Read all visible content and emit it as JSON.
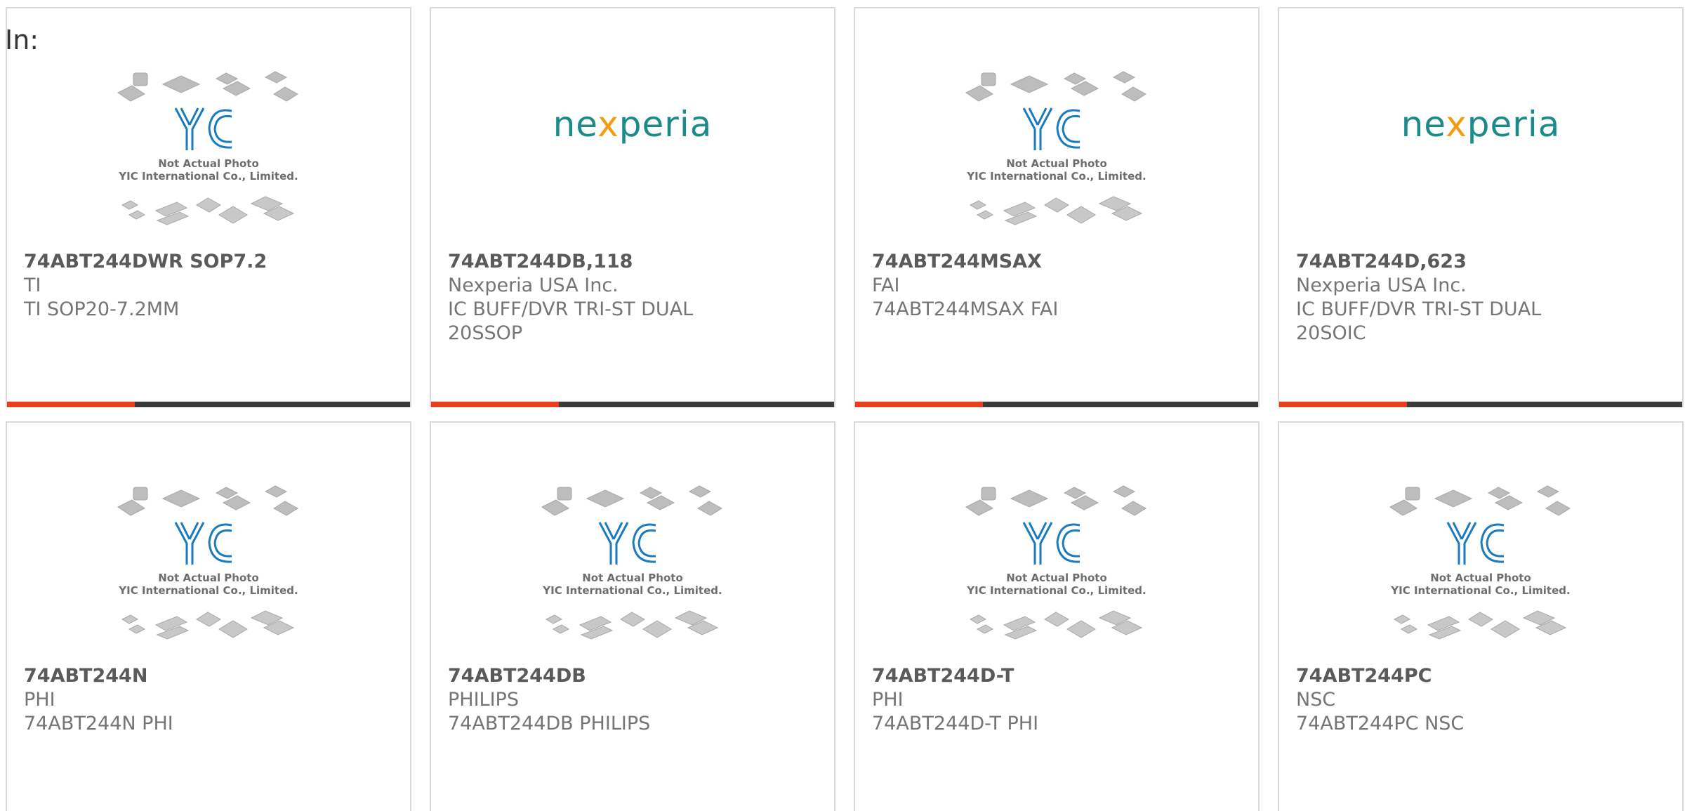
{
  "heading": "In:",
  "colors": {
    "accent": "#e8401c",
    "bar_dark": "#3b3b3b",
    "nexperia_teal": "#1d8a8a",
    "nexperia_orange": "#f39c12",
    "yic_blue": "#1a7bbd"
  },
  "placeholder_image": {
    "caption_line1": "Not Actual Photo",
    "caption_line2": "YIC International Co., Limited.",
    "logo_text": "YIC"
  },
  "nexperia_logo": {
    "before": "ne",
    "x": "x",
    "after": "peria"
  },
  "products": [
    {
      "name": "74ABT244DWR SOP7.2",
      "manufacturer": "TI",
      "description": "TI SOP20-7.2MM",
      "description2": "",
      "image": "yic-placeholder",
      "has_bar": true
    },
    {
      "name": "74ABT244DB,118",
      "manufacturer": "Nexperia USA Inc.",
      "description": "IC BUFF/DVR TRI-ST DUAL",
      "description2": "20SSOP",
      "image": "nexperia-logo",
      "has_bar": true
    },
    {
      "name": "74ABT244MSAX",
      "manufacturer": "FAI",
      "description": "74ABT244MSAX FAI",
      "description2": "",
      "image": "yic-placeholder",
      "has_bar": true
    },
    {
      "name": "74ABT244D,623",
      "manufacturer": "Nexperia USA Inc.",
      "description": "IC BUFF/DVR TRI-ST DUAL",
      "description2": "20SOIC",
      "image": "nexperia-logo",
      "has_bar": true
    },
    {
      "name": "74ABT244N",
      "manufacturer": "PHI",
      "description": "74ABT244N PHI",
      "description2": "",
      "image": "yic-placeholder",
      "has_bar": false
    },
    {
      "name": "74ABT244DB",
      "manufacturer": "PHILIPS",
      "description": "74ABT244DB PHILIPS",
      "description2": "",
      "image": "yic-placeholder",
      "has_bar": false
    },
    {
      "name": "74ABT244D-T",
      "manufacturer": "PHI",
      "description": "74ABT244D-T PHI",
      "description2": "",
      "image": "yic-placeholder",
      "has_bar": false
    },
    {
      "name": "74ABT244PC",
      "manufacturer": "NSC",
      "description": "74ABT244PC NSC",
      "description2": "",
      "image": "yic-placeholder",
      "has_bar": false
    }
  ]
}
